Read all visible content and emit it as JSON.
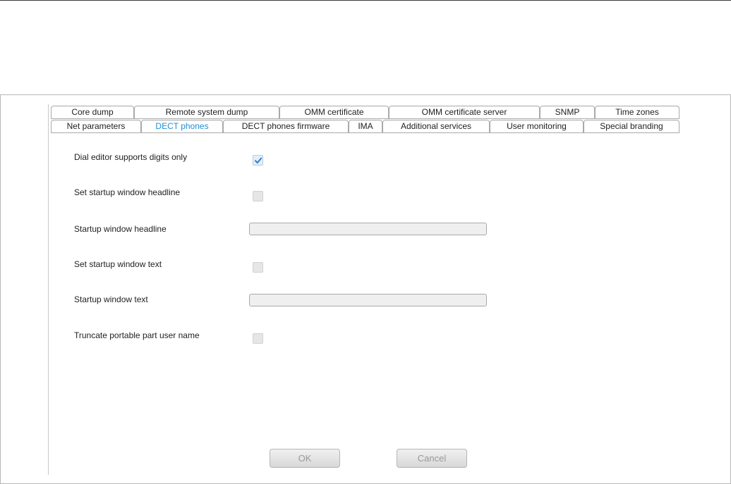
{
  "tabs": {
    "row1": [
      {
        "label": "Core dump"
      },
      {
        "label": "Remote system dump"
      },
      {
        "label": "OMM certificate"
      },
      {
        "label": "OMM certificate server"
      },
      {
        "label": "SNMP"
      },
      {
        "label": "Time zones"
      }
    ],
    "row2": [
      {
        "label": "Net parameters"
      },
      {
        "label": "DECT phones",
        "active": true
      },
      {
        "label": "DECT phones firmware"
      },
      {
        "label": "IMA"
      },
      {
        "label": "Additional services"
      },
      {
        "label": "User monitoring"
      },
      {
        "label": "Special branding"
      }
    ]
  },
  "form": {
    "dial_digits_only": {
      "label": "Dial editor supports digits only",
      "checked": true
    },
    "set_headline": {
      "label": "Set startup window headline",
      "checked": false
    },
    "headline": {
      "label": "Startup window headline",
      "value": ""
    },
    "set_text": {
      "label": "Set startup window text",
      "checked": false
    },
    "text": {
      "label": "Startup window text",
      "value": ""
    },
    "truncate_name": {
      "label": "Truncate portable part user name",
      "checked": false
    }
  },
  "buttons": {
    "ok": "OK",
    "cancel": "Cancel"
  },
  "colors": {
    "active_tab": "#1e8fd5",
    "border": "#a9a9a9"
  }
}
